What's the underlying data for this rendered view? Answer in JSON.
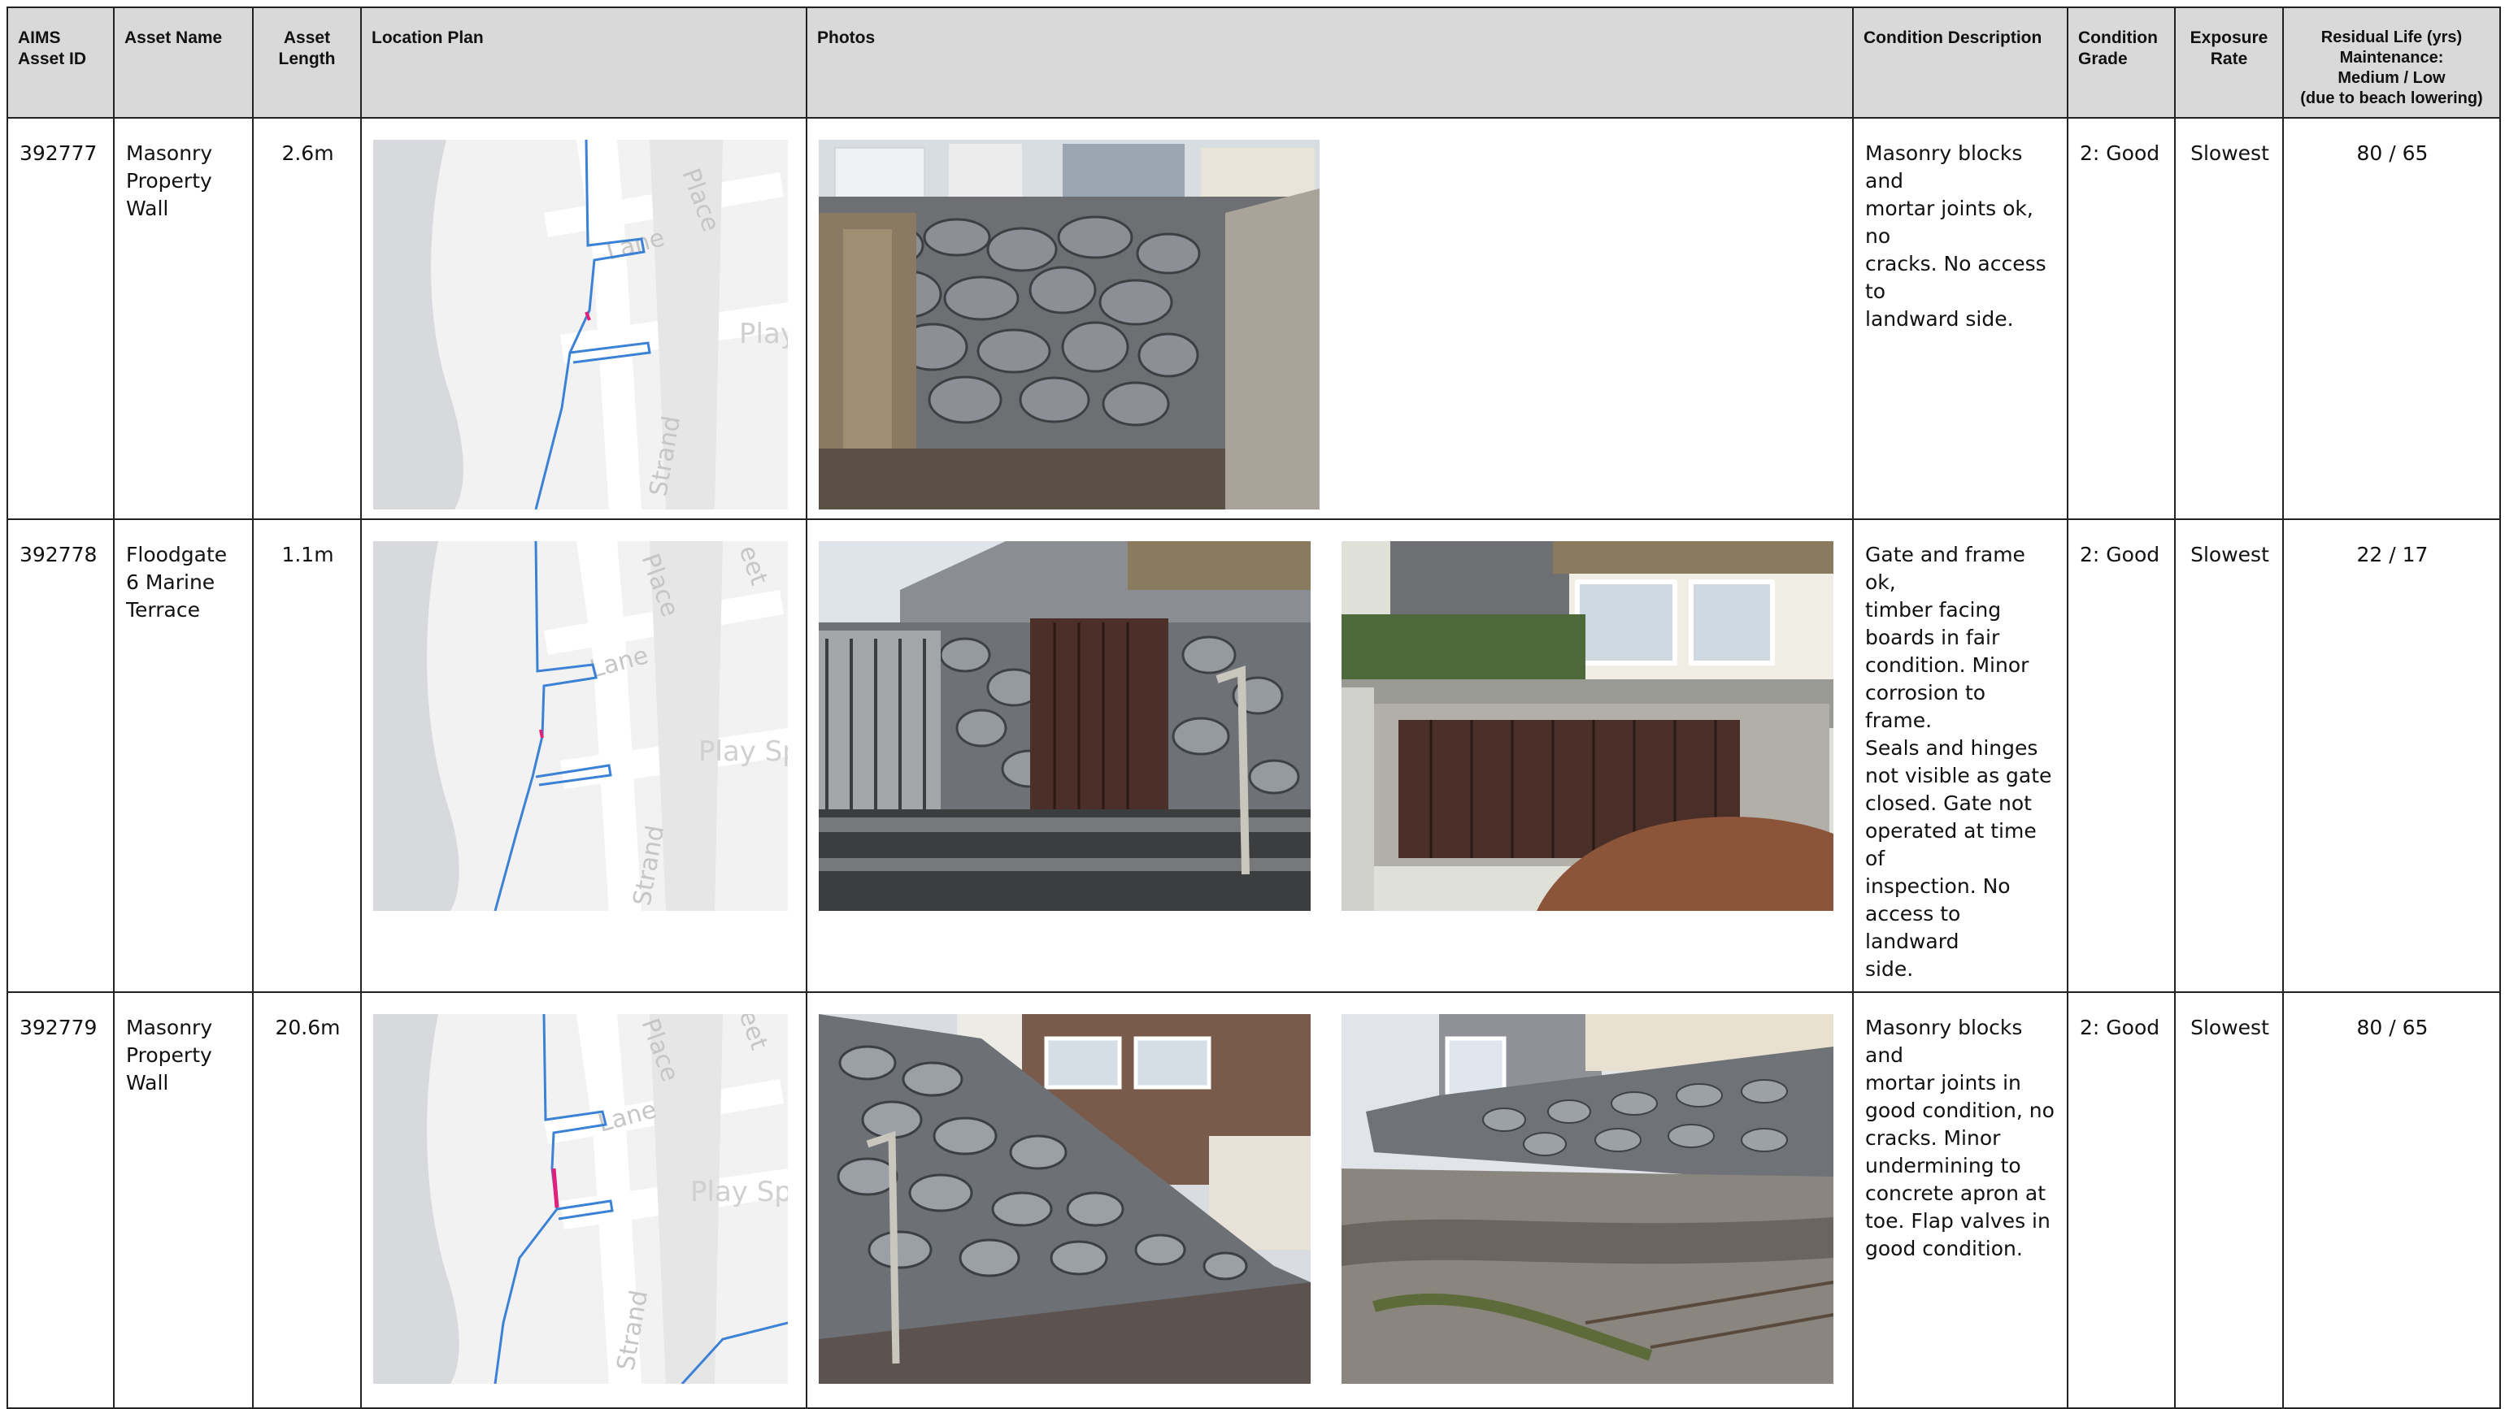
{
  "headers": {
    "asset_id": "AIMS\nAsset ID",
    "asset_name": "Asset Name",
    "asset_length": "Asset\nLength",
    "location_plan": "Location Plan",
    "photos": "Photos",
    "condition_description": "Condition Description",
    "condition_grade": "Condition\nGrade",
    "exposure_rate": "Exposure\nRate",
    "residual_life": "Residual Life (yrs)\nMaintenance:\nMedium / Low\n(due to beach lowering)"
  },
  "map_labels": {
    "lane": "Lane",
    "place": "Place",
    "play": "Play Sp",
    "strand": "Strand",
    "street": "eet"
  },
  "rows": [
    {
      "id": "392777",
      "name": "Masonry\nProperty\nWall",
      "length": "2.6m",
      "description": "Masonry blocks and\nmortar joints ok, no\ncracks. No access to\nlandward side.",
      "grade": "2: Good",
      "exposure": "Slowest",
      "residual": "80 / 65",
      "photos": [
        "masonry-wall-photo"
      ]
    },
    {
      "id": "392778",
      "name": "Floodgate\n6 Marine\nTerrace",
      "length": "1.1m",
      "description": "Gate and frame ok,\ntimber facing\nboards in fair\ncondition. Minor\ncorrosion to frame.\nSeals and hinges\nnot visible as gate\nclosed. Gate not\noperated at time of\ninspection. No\naccess to landward\nside.",
      "grade": "2: Good",
      "exposure": "Slowest",
      "residual": "22 / 17",
      "photos": [
        "floodgate-front-photo",
        "floodgate-detail-photo"
      ]
    },
    {
      "id": "392779",
      "name": "Masonry\nProperty\nWall",
      "length": "20.6m",
      "description": "Masonry blocks and\nmortar joints in\ngood condition, no\ncracks. Minor\nundermining to\nconcrete apron at\ntoe. Flap valves in\ngood condition.",
      "grade": "2: Good",
      "exposure": "Slowest",
      "residual": "80 / 65",
      "photos": [
        "long-wall-photo",
        "wall-apron-photo"
      ]
    }
  ],
  "colors": {
    "header_bg": "#d9d9d9",
    "map_bg": "#f1f1f1",
    "map_sea": "#d7d9dc",
    "asset_line": "#3b82d6",
    "asset_highlight": "#e0207a"
  }
}
